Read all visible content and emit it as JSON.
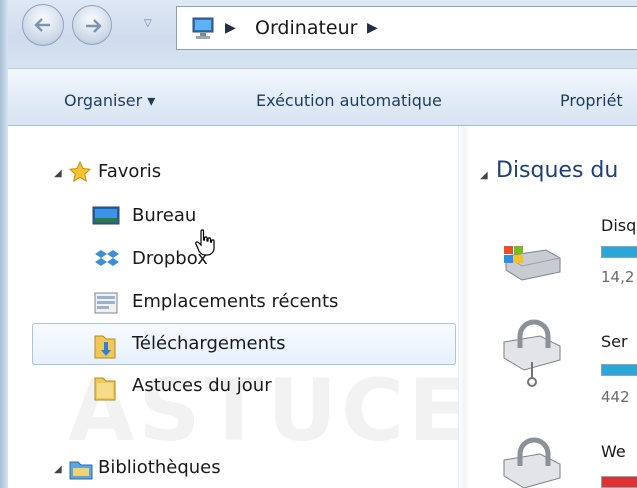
{
  "address": {
    "location": "Ordinateur"
  },
  "toolbar": {
    "organize_label": "Organiser ▾",
    "autoplay_label": "Exécution automatique",
    "properties_label": "Propriét"
  },
  "nav": {
    "favorites": {
      "label": "Favoris",
      "items": [
        {
          "label": "Bureau",
          "icon": "desktop-icon"
        },
        {
          "label": "Dropbox",
          "icon": "dropbox-icon"
        },
        {
          "label": "Emplacements récents",
          "icon": "recent-places-icon"
        },
        {
          "label": "Téléchargements",
          "icon": "downloads-folder-icon",
          "selected": true
        },
        {
          "label": "Astuces du jour",
          "icon": "folder-icon"
        }
      ]
    },
    "libraries": {
      "label": "Bibliothèques"
    }
  },
  "content": {
    "group_title": "Disques du",
    "drives": [
      {
        "name": "Disq",
        "size": "14,2",
        "icon": "windows-drive-icon",
        "bar_color": "#2aa7d8"
      },
      {
        "name": "Ser",
        "size": "442",
        "icon": "network-drive-icon",
        "bar_color": "#2aa7d8"
      },
      {
        "name": "We",
        "size": "",
        "icon": "network-drive-icon",
        "bar_color": "#e03030"
      }
    ]
  },
  "colors": {
    "accent": "#1e3f78",
    "selection_border": "#a7c6e6"
  }
}
